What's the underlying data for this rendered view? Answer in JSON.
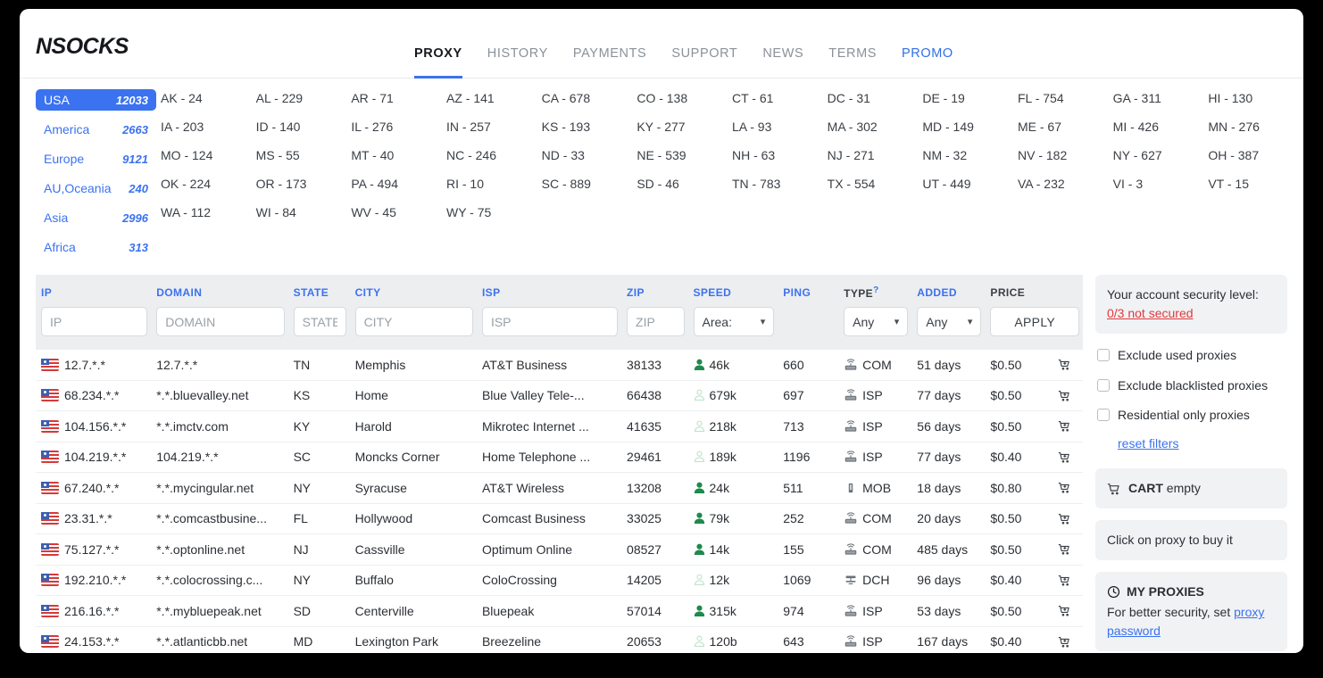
{
  "brand": {
    "logo": "NSOCKS"
  },
  "nav": {
    "items": [
      {
        "label": "PROXY",
        "state": "active"
      },
      {
        "label": "HISTORY",
        "state": "normal"
      },
      {
        "label": "PAYMENTS",
        "state": "normal"
      },
      {
        "label": "SUPPORT",
        "state": "normal"
      },
      {
        "label": "NEWS",
        "state": "normal"
      },
      {
        "label": "TERMS",
        "state": "normal"
      },
      {
        "label": "PROMO",
        "state": "promo"
      }
    ]
  },
  "regions": [
    {
      "name": "USA",
      "count": "12033",
      "selected": true
    },
    {
      "name": "America",
      "count": "2663",
      "selected": false
    },
    {
      "name": "Europe",
      "count": "9121",
      "selected": false
    },
    {
      "name": "AU,Oceania",
      "count": "240",
      "selected": false
    },
    {
      "name": "Asia",
      "count": "2996",
      "selected": false
    },
    {
      "name": "Africa",
      "count": "313",
      "selected": false
    }
  ],
  "states": [
    "AK - 24",
    "AL - 229",
    "AR - 71",
    "AZ - 141",
    "CA - 678",
    "CO - 138",
    "CT - 61",
    "DC - 31",
    "DE - 19",
    "FL - 754",
    "GA - 311",
    "HI - 130",
    "IA - 203",
    "ID - 140",
    "IL - 276",
    "IN - 257",
    "KS - 193",
    "KY - 277",
    "LA - 93",
    "MA - 302",
    "MD - 149",
    "ME - 67",
    "MI - 426",
    "MN - 276",
    "MO - 124",
    "MS - 55",
    "MT - 40",
    "NC - 246",
    "ND - 33",
    "NE - 539",
    "NH - 63",
    "NJ - 271",
    "NM - 32",
    "NV - 182",
    "NY - 627",
    "OH - 387",
    "OK - 224",
    "OR - 173",
    "PA - 494",
    "RI - 10",
    "SC - 889",
    "SD - 46",
    "TN - 783",
    "TX - 554",
    "UT - 449",
    "VA - 232",
    "VI - 3",
    "VT - 15",
    "WA - 112",
    "WI - 84",
    "WV - 45",
    "WY - 75"
  ],
  "table": {
    "headers": [
      {
        "label": "IP",
        "sortable": true
      },
      {
        "label": "DOMAIN",
        "sortable": true
      },
      {
        "label": "STATE",
        "sortable": true
      },
      {
        "label": "CITY",
        "sortable": true
      },
      {
        "label": "ISP",
        "sortable": true
      },
      {
        "label": "ZIP",
        "sortable": true
      },
      {
        "label": "SPEED",
        "sortable": true
      },
      {
        "label": "PING",
        "sortable": true
      },
      {
        "label": "TYPE",
        "sortable": false,
        "help": "?"
      },
      {
        "label": "ADDED",
        "sortable": true
      },
      {
        "label": "PRICE",
        "sortable": false
      }
    ],
    "filters": {
      "ip_placeholder": "IP",
      "domain_placeholder": "DOMAIN",
      "state_placeholder": "STATE",
      "city_placeholder": "CITY",
      "isp_placeholder": "ISP",
      "zip_placeholder": "ZIP",
      "speed_select": "Area:",
      "type_select": "Any",
      "added_select": "Any",
      "apply_label": "APPLY"
    },
    "rows": [
      {
        "flag": "us-flag-icon",
        "ip": "12.7.*.*",
        "domain": "12.7.*.*",
        "state": "TN",
        "city": "Memphis",
        "isp": "AT&T Business",
        "zip": "38133",
        "speed": "46k",
        "speed_level": "high",
        "ping": "660",
        "type": "COM",
        "type_icon": "router-icon",
        "added": "51 days",
        "price": "$0.50"
      },
      {
        "flag": "us-flag-icon",
        "ip": "68.234.*.*",
        "domain": "*.*.bluevalley.net",
        "state": "KS",
        "city": "Home",
        "isp": "Blue Valley Tele-...",
        "zip": "66438",
        "speed": "679k",
        "speed_level": "low",
        "ping": "697",
        "type": "ISP",
        "type_icon": "router-icon",
        "added": "77 days",
        "price": "$0.50"
      },
      {
        "flag": "us-flag-icon",
        "ip": "104.156.*.*",
        "domain": "*.*.imctv.com",
        "state": "KY",
        "city": "Harold",
        "isp": "Mikrotec Internet ...",
        "zip": "41635",
        "speed": "218k",
        "speed_level": "low",
        "ping": "713",
        "type": "ISP",
        "type_icon": "router-icon",
        "added": "56 days",
        "price": "$0.50"
      },
      {
        "flag": "us-flag-icon",
        "ip": "104.219.*.*",
        "domain": "104.219.*.*",
        "state": "SC",
        "city": "Moncks Corner",
        "isp": "Home Telephone ...",
        "zip": "29461",
        "speed": "189k",
        "speed_level": "low",
        "ping": "1196",
        "type": "ISP",
        "type_icon": "router-icon",
        "added": "77 days",
        "price": "$0.40"
      },
      {
        "flag": "us-flag-icon",
        "ip": "67.240.*.*",
        "domain": "*.*.mycingular.net",
        "state": "NY",
        "city": "Syracuse",
        "isp": "AT&T Wireless",
        "zip": "13208",
        "speed": "24k",
        "speed_level": "high",
        "ping": "511",
        "type": "MOB",
        "type_icon": "mobile-icon",
        "added": "18 days",
        "price": "$0.80"
      },
      {
        "flag": "us-flag-icon",
        "ip": "23.31.*.*",
        "domain": "*.*.comcastbusine...",
        "state": "FL",
        "city": "Hollywood",
        "isp": "Comcast Business",
        "zip": "33025",
        "speed": "79k",
        "speed_level": "high",
        "ping": "252",
        "type": "COM",
        "type_icon": "router-icon",
        "added": "20 days",
        "price": "$0.50"
      },
      {
        "flag": "us-flag-icon",
        "ip": "75.127.*.*",
        "domain": "*.*.optonline.net",
        "state": "NJ",
        "city": "Cassville",
        "isp": "Optimum Online",
        "zip": "08527",
        "speed": "14k",
        "speed_level": "high",
        "ping": "155",
        "type": "COM",
        "type_icon": "router-icon",
        "added": "485 days",
        "price": "$0.50"
      },
      {
        "flag": "us-flag-icon",
        "ip": "192.210.*.*",
        "domain": "*.*.colocrossing.c...",
        "state": "NY",
        "city": "Buffalo",
        "isp": "ColoCrossing",
        "zip": "14205",
        "speed": "12k",
        "speed_level": "low",
        "ping": "1069",
        "type": "DCH",
        "type_icon": "server-icon",
        "added": "96 days",
        "price": "$0.40"
      },
      {
        "flag": "us-flag-icon",
        "ip": "216.16.*.*",
        "domain": "*.*.mybluepeak.net",
        "state": "SD",
        "city": "Centerville",
        "isp": "Bluepeak",
        "zip": "57014",
        "speed": "315k",
        "speed_level": "high",
        "ping": "974",
        "type": "ISP",
        "type_icon": "router-icon",
        "added": "53 days",
        "price": "$0.50"
      },
      {
        "flag": "us-flag-icon",
        "ip": "24.153.*.*",
        "domain": "*.*.atlanticbb.net",
        "state": "MD",
        "city": "Lexington Park",
        "isp": "Breezeline",
        "zip": "20653",
        "speed": "120b",
        "speed_level": "low",
        "ping": "643",
        "type": "ISP",
        "type_icon": "router-icon",
        "added": "167 days",
        "price": "$0.40"
      }
    ]
  },
  "sidebar": {
    "security": {
      "text_before": "Your account security level: ",
      "link": "0/3 not secured"
    },
    "checkboxes": [
      {
        "label": "Exclude used proxies",
        "checked": false
      },
      {
        "label": "Exclude blacklisted proxies",
        "checked": false
      },
      {
        "label": "Residential only proxies",
        "checked": false
      }
    ],
    "reset_label": "reset filters",
    "cart": {
      "title": "CART",
      "status": "empty"
    },
    "hint": "Click on proxy to buy it",
    "my_proxies": {
      "title": "MY PROXIES",
      "text_before": "For better security, set ",
      "link": "proxy password"
    }
  },
  "colors": {
    "accent": "#3b72f0",
    "danger": "#e0393b",
    "speed_high": "#1e8a4c",
    "speed_low": "#bfe3cd"
  }
}
